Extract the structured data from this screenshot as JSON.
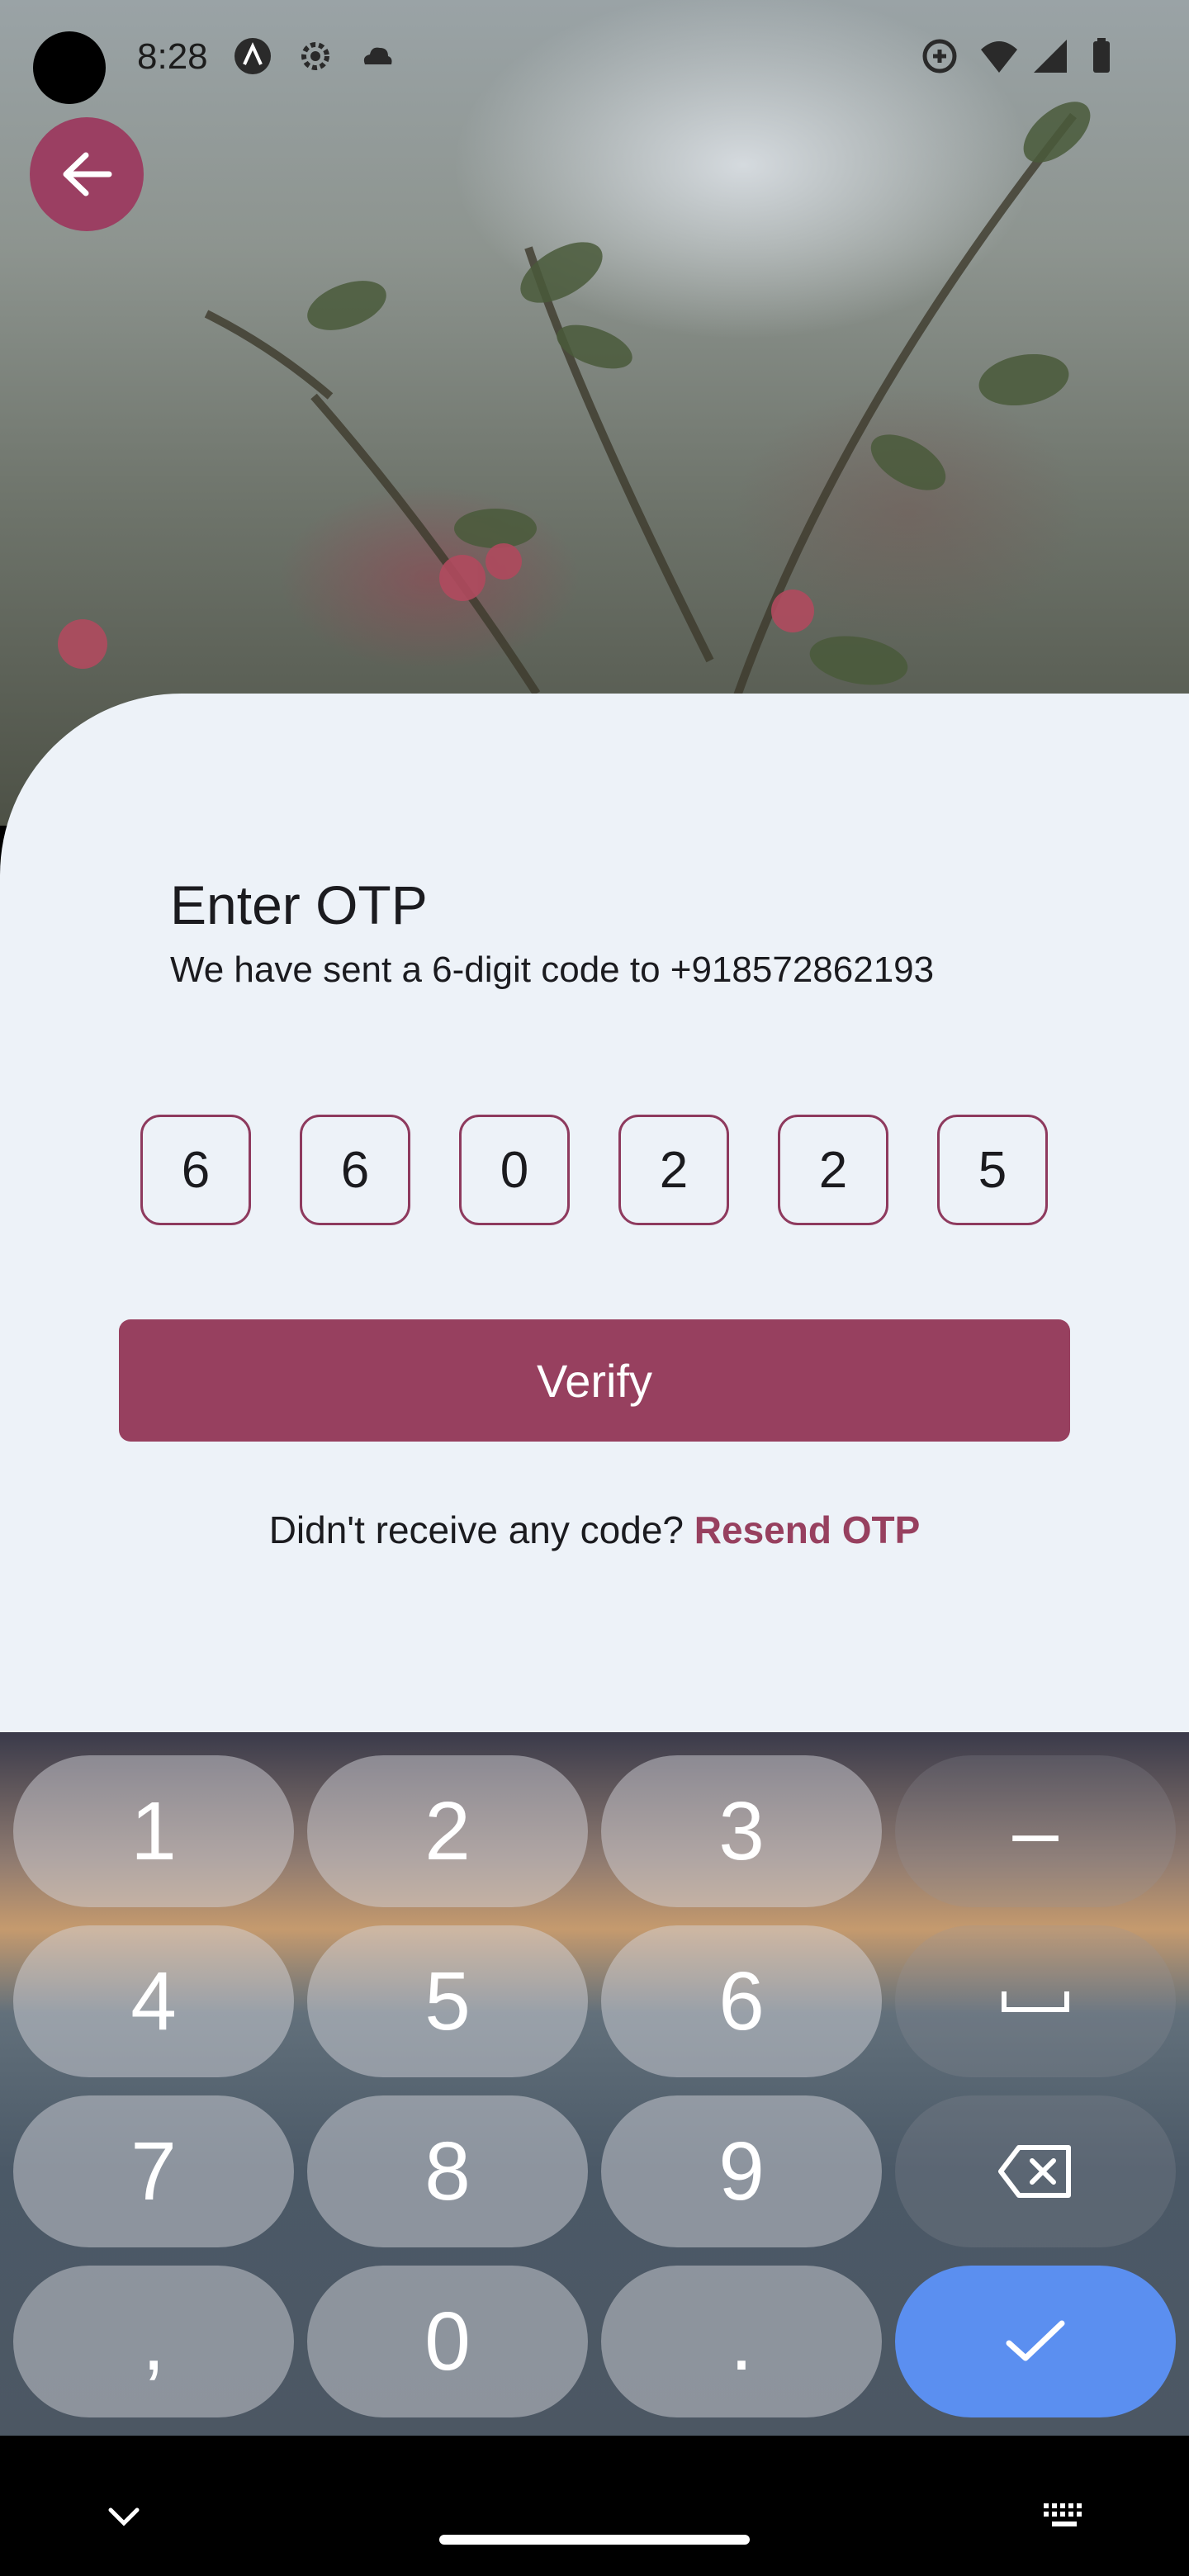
{
  "status_bar": {
    "time": "8:28",
    "icons": [
      "a-icon",
      "gear-icon",
      "cloud-icon",
      "data-saver-icon",
      "wifi-icon",
      "signal-icon",
      "battery-icon"
    ]
  },
  "header": {
    "back_icon": "arrow-left-icon"
  },
  "otp": {
    "title": "Enter OTP",
    "subtitle": "We have sent a 6-digit code to +918572862193",
    "digits": [
      "6",
      "6",
      "0",
      "2",
      "2",
      "5"
    ]
  },
  "verify_label": "Verify",
  "resend": {
    "prompt": "Didn't receive any code?",
    "link": "Resend OTP"
  },
  "keyboard": {
    "keys": [
      "1",
      "2",
      "3",
      "–",
      "4",
      "5",
      "6",
      "␣",
      "7",
      "8",
      "9",
      "backspace",
      ",",
      "0",
      ".",
      "done"
    ]
  },
  "colors": {
    "accent": "#97405f",
    "card": "#edf2f8",
    "done_key": "#5b8ff0"
  }
}
